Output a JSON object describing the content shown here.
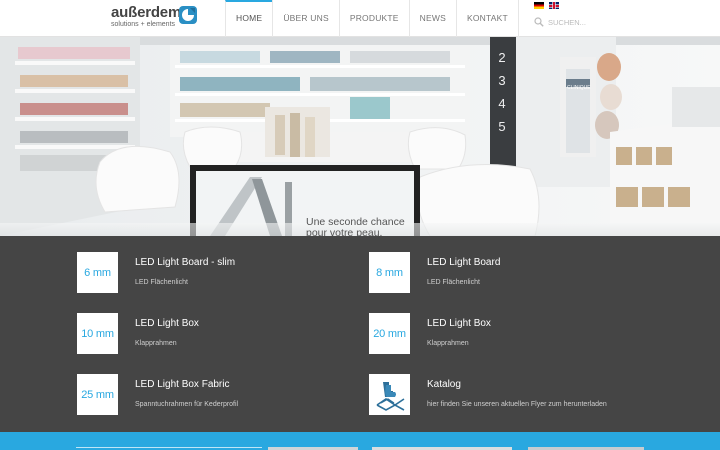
{
  "logo": {
    "name": "außerdem",
    "tagline": "solutions + elements"
  },
  "nav": {
    "items": [
      {
        "label": "HOME",
        "active": true
      },
      {
        "label": "ÜBER UNS",
        "active": false
      },
      {
        "label": "PRODUKTE",
        "active": false
      },
      {
        "label": "NEWS",
        "active": false
      },
      {
        "label": "KONTAKT",
        "active": false
      }
    ]
  },
  "languages": [
    "de-flag",
    "en-flag"
  ],
  "search": {
    "placeholder": "SUCHEN...",
    "icon": "search-icon"
  },
  "hero": {
    "slide_numbers": [
      "2",
      "3",
      "4",
      "5"
    ],
    "caption_line1": "Une seconde chance",
    "caption_line2": "pour votre peau."
  },
  "products": [
    {
      "box": "6 mm",
      "title": "LED Light Board - slim",
      "subtitle": "LED Flächenlicht"
    },
    {
      "box": "8 mm",
      "title": "LED Light Board",
      "subtitle": "LED Flächenlicht"
    },
    {
      "box": "10 mm",
      "title": "LED Light Box",
      "subtitle": "Klapprahmen"
    },
    {
      "box": "20 mm",
      "title": "LED Light Box",
      "subtitle": "Klapprahmen"
    },
    {
      "box": "25 mm",
      "title": "LED Light Box Fabric",
      "subtitle": "Spanntuchrahmen für Kederprofil"
    },
    {
      "box": "",
      "icon": "catalog-hand-icon",
      "title": "Katalog",
      "subtitle": "hier finden Sie unseren aktuellen Flyer zum herunterladen"
    }
  ],
  "colors": {
    "accent": "#29a8e0",
    "panel": "#454545",
    "logo_mark": "#2a8fc4"
  }
}
